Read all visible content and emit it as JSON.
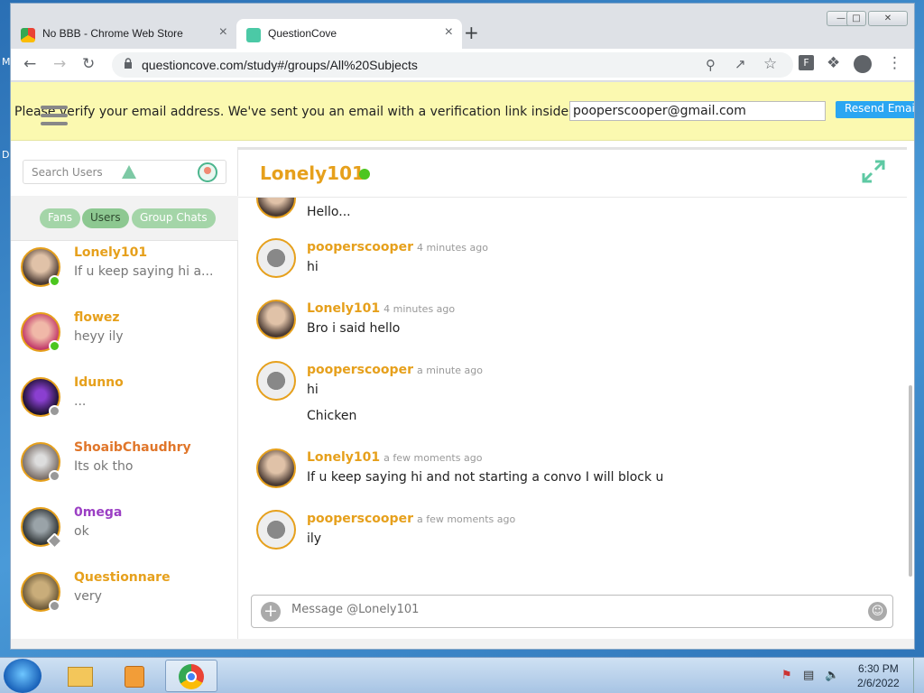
{
  "browser": {
    "tabs": [
      {
        "title": "No BBB - Chrome Web Store",
        "active": false
      },
      {
        "title": "QuestionCove",
        "active": true
      }
    ],
    "url": "questioncove.com/study#/groups/All%20Subjects"
  },
  "banner": {
    "message": "Please verify your email address. We've sent you an email with a verification link inside.",
    "email_value": "pooperscooper@gmail.com",
    "resend_label": "Resend Email"
  },
  "sidebar": {
    "search_placeholder": "Search Users",
    "filters": [
      "Fans",
      "Users",
      "Group Chats"
    ],
    "selected_filter": "Users",
    "conversations": [
      {
        "name": "Lonely101",
        "preview": "If u keep saying hi a...",
        "name_color": "#e6a01c",
        "status": "online"
      },
      {
        "name": "flowez",
        "preview": "heyy ily",
        "name_color": "#e6a01c",
        "status": "online"
      },
      {
        "name": "Idunno",
        "preview": "...",
        "name_color": "#e6a01c",
        "status": "offline"
      },
      {
        "name": "ShoaibChaudhry",
        "preview": "Its ok tho",
        "name_color": "#e0762a",
        "status": "offline"
      },
      {
        "name": "0mega",
        "preview": "ok",
        "name_color": "#9b3fc4",
        "status": "away"
      },
      {
        "name": "Questionnare",
        "preview": "very",
        "name_color": "#e6a01c",
        "status": "offline"
      }
    ]
  },
  "chat": {
    "partner": "Lonely101",
    "partner_status": "online",
    "messages": [
      {
        "author": "Lonely101",
        "time": "",
        "lines": [
          "Hello..."
        ]
      },
      {
        "author": "pooperscooper",
        "time": "4 minutes ago",
        "lines": [
          "hi"
        ]
      },
      {
        "author": "Lonely101",
        "time": "4 minutes ago",
        "lines": [
          "Bro i said hello"
        ]
      },
      {
        "author": "pooperscooper",
        "time": "a minute ago",
        "lines": [
          "hi",
          "Chicken"
        ]
      },
      {
        "author": "Lonely101",
        "time": "a few moments ago",
        "lines": [
          "If u keep saying hi and not starting a convo I will block u"
        ]
      },
      {
        "author": "pooperscooper",
        "time": "a few moments ago",
        "lines": [
          "ily"
        ]
      }
    ],
    "input_placeholder": "Message @Lonely101"
  },
  "taskbar": {
    "time": "6:30 PM",
    "date": "2/6/2022"
  },
  "colors": {
    "accent": "#e6a01c",
    "online": "#4cc61f",
    "pill": "#a4d5a8",
    "banner": "#fbf9b0"
  }
}
